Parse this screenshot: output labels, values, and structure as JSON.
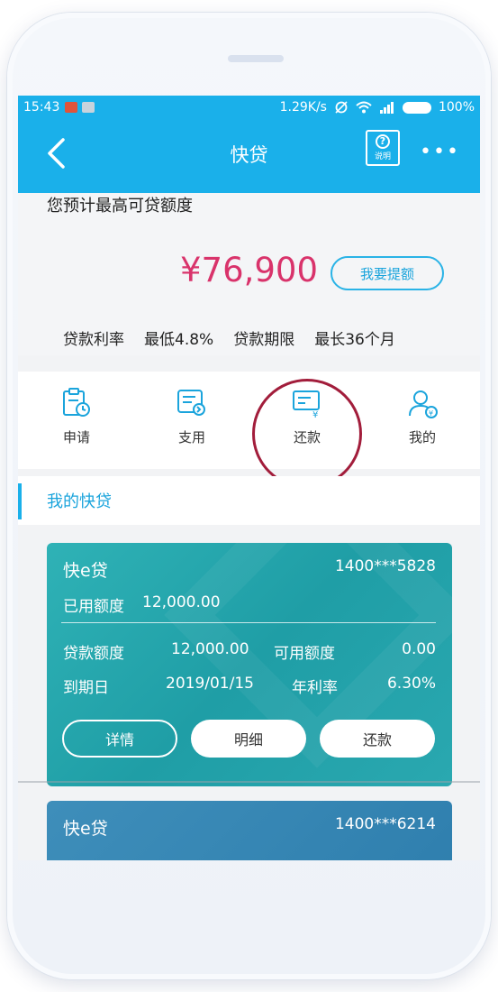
{
  "status_bar": {
    "time": "15:43",
    "network_speed": "1.29K/s",
    "battery": "100%"
  },
  "nav": {
    "title": "快贷",
    "help_label": "说明",
    "help_symbol": "?",
    "more": "•••"
  },
  "quota": {
    "label": "您预计最高可贷额度",
    "amount": "¥76,900",
    "raise_button": "我要提额",
    "rate_label": "贷款利率",
    "rate_value": "最低4.8%",
    "term_label": "贷款期限",
    "term_value": "最长36个月"
  },
  "actions": [
    {
      "label": "申请",
      "icon": "apply-icon"
    },
    {
      "label": "支用",
      "icon": "withdraw-icon"
    },
    {
      "label": "还款",
      "icon": "repay-icon"
    },
    {
      "label": "我的",
      "icon": "profile-icon"
    }
  ],
  "section_title": "我的快贷",
  "cards": [
    {
      "name": "快e贷",
      "account": "1400***5828",
      "used_label": "已用额度",
      "used_value": "12,000.00",
      "loan_label": "贷款额度",
      "loan_value": "12,000.00",
      "available_label": "可用额度",
      "available_value": "0.00",
      "due_label": "到期日",
      "due_value": "2019/01/15",
      "apr_label": "年利率",
      "apr_value": "6.30%",
      "buttons": [
        "详情",
        "明细",
        "还款"
      ]
    },
    {
      "name": "快e贷",
      "account": "1400***6214"
    }
  ],
  "colors": {
    "header": "#1ab0ea",
    "amount": "#d9336b",
    "card": "#26a6ad",
    "highlight_circle": "#a21d3b"
  }
}
